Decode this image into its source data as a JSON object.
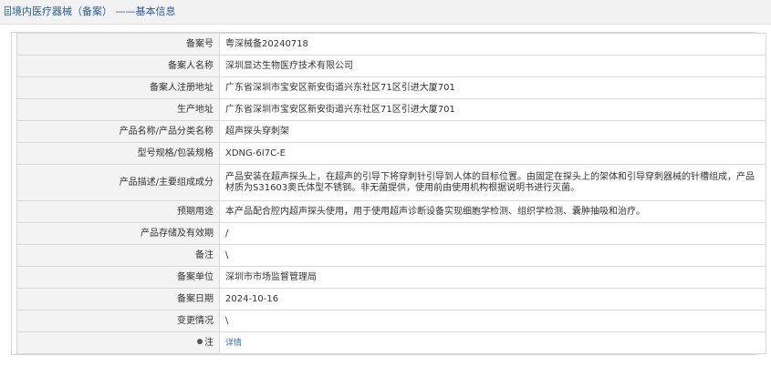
{
  "header": {
    "title": "境内医疗器械（备案） ——基本信息",
    "icon": "document-icon"
  },
  "rows": [
    {
      "label": "备案号",
      "value": "粤深械备20240718"
    },
    {
      "label": "备案人名称",
      "value": "深圳显达生物医疗技术有限公司"
    },
    {
      "label": "备案人注册地址",
      "value": "广东省深圳市宝安区新安街道兴东社区71区引进大厦701"
    },
    {
      "label": "生产地址",
      "value": "广东省深圳市宝安区新安街道兴东社区71区引进大厦701"
    },
    {
      "label": "产品名称/产品分类名称",
      "value": "超声探头穿刺架"
    },
    {
      "label": "型号规格/包装规格",
      "value": "XDNG-6I7C-E"
    },
    {
      "label": "产品描述/主要组成成分",
      "value": "产品安装在超声探头上，在超声的引导下将穿刺针引导到人体的目标位置。由固定在探头上的架体和引导穿刺器械的针槽组成，产品材质为S31603奥氏体型不锈钢。非无菌提供，使用前由使用机构根据说明书进行灭菌。"
    },
    {
      "label": "预期用途",
      "value": "本产品配合腔内超声探头使用，用于使用超声诊断设备实现细胞学检测、组织学检测、囊肿抽吸和治疗。"
    },
    {
      "label": "产品存储及有效期",
      "value": "/"
    },
    {
      "label": "备注",
      "value": "\\"
    },
    {
      "label": "备案单位",
      "value": "深圳市市场监督管理局"
    },
    {
      "label": "备案日期",
      "value": "2024-10-16"
    },
    {
      "label": "变更情况",
      "value": "\\"
    }
  ],
  "note_row": {
    "label": "注",
    "icon": "pin-icon",
    "link": "详情"
  },
  "colors": {
    "header_title": "#2c5a91",
    "label_bg": "#f3f3f3",
    "border": "#d8d8d8",
    "link": "#2c6fbf"
  }
}
